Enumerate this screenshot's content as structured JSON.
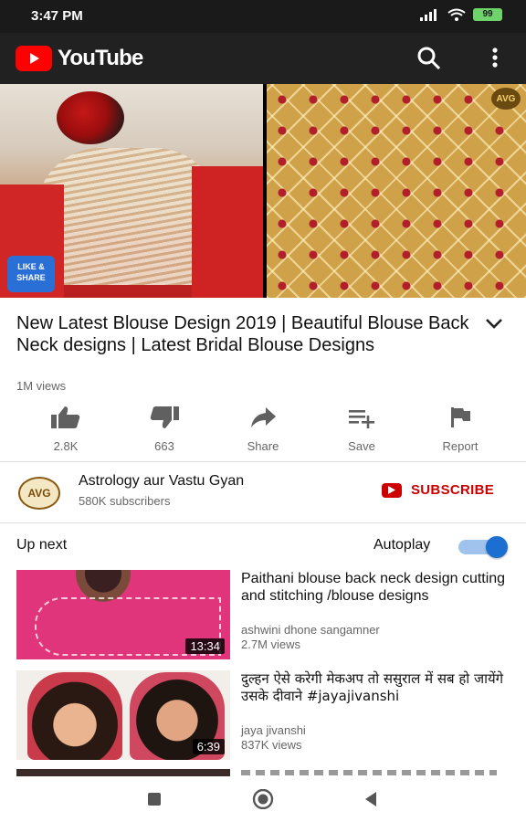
{
  "status_bar": {
    "time": "3:47 PM",
    "battery": "99"
  },
  "app": {
    "name": "YouTube"
  },
  "video": {
    "title": "New Latest Blouse Design 2019 | Beautiful Blouse Back Neck designs | Latest Bridal Blouse Designs",
    "views": "1M views",
    "watermark": "AVG",
    "badge_text": "LIKE & SHARE"
  },
  "actions": [
    {
      "label": "2.8K",
      "icon": "thumbs-up-icon"
    },
    {
      "label": "663",
      "icon": "thumbs-down-icon"
    },
    {
      "label": "Share",
      "icon": "share-icon"
    },
    {
      "label": "Save",
      "icon": "save-to-playlist-icon"
    },
    {
      "label": "Report",
      "icon": "flag-icon"
    }
  ],
  "channel": {
    "name": "Astrology aur Vastu Gyan",
    "subscribers": "580K subscribers",
    "avatar_text": "AVG",
    "subscribe_label": "SUBSCRIBE"
  },
  "up_next": {
    "label": "Up next",
    "autoplay_label": "Autoplay",
    "autoplay_on": true
  },
  "recommendations": [
    {
      "title": "Paithani blouse back neck design cutting and stitching /blouse designs",
      "channel": "ashwini dhone sangamner",
      "views": "2.7M views",
      "duration": "13:34"
    },
    {
      "title": "दुल्हन ऐसे करेगी मेकअप तो ससुराल में सब हो जायेंगे उसके दीवाने #jayajivanshi",
      "channel": "jaya jivanshi",
      "views": "837K views",
      "duration": "6:39"
    }
  ],
  "colors": {
    "brand_red": "#ff0000",
    "subscribe_red": "#cc0000",
    "toggle_blue": "#1c6fd1"
  }
}
